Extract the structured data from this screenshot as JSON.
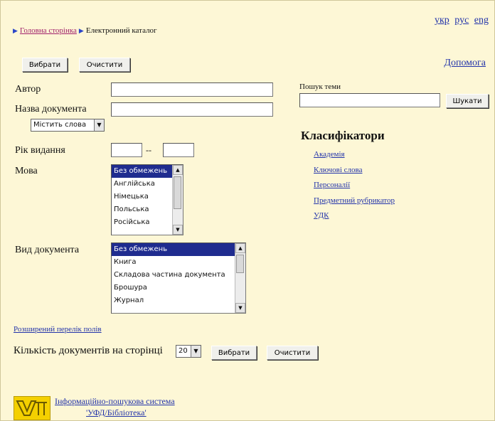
{
  "languages": [
    "укр",
    "рус",
    "eng"
  ],
  "breadcrumb": {
    "home": "Головна сторінка",
    "current": "Електронний каталог"
  },
  "top_buttons": {
    "select": "Вибрати",
    "clear": "Очистити"
  },
  "help": "Допомога",
  "form": {
    "author_label": "Автор",
    "title_label": "Назва документа",
    "title_mode": "Містить слова",
    "year_label": "Рік видання",
    "year_sep": "--",
    "language_label": "Мова",
    "language_options": [
      "Без обмежень",
      "Англійська",
      "Німецька",
      "Польська",
      "Російська"
    ],
    "language_selected": "Без обмежень",
    "doc_type_label": "Вид документа",
    "doc_type_options": [
      "Без обмежень",
      "Книга",
      "Складова частина документа",
      "Брошура",
      "Журнал"
    ],
    "doc_type_selected": "Без обмежень",
    "extended_fields_link": "Розширений перелік полів",
    "per_page_label": "Кількість документів на сторінці",
    "per_page_value": "20",
    "bottom_select": "Вибрати",
    "bottom_clear": "Очистити"
  },
  "topic_search": {
    "label": "Пошук теми",
    "button": "Шукати"
  },
  "classifiers": {
    "title": "Класифікатори",
    "items": [
      "Академія",
      "Ключові слова",
      "Персоналії",
      "Предметний рубрикатор",
      "УДК"
    ]
  },
  "footer": {
    "line1": "Інформаційно-пошукова система",
    "line2": "'УФД/Бібліотека'"
  }
}
